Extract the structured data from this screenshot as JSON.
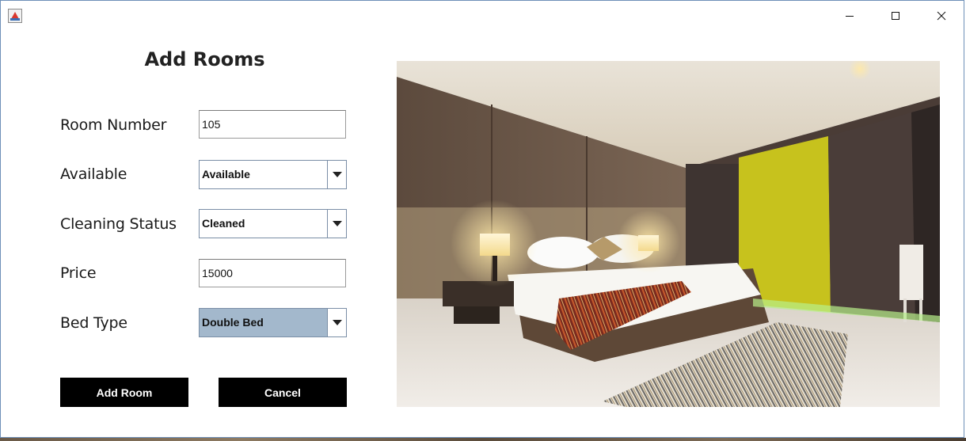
{
  "window": {
    "title_icon": "java-app-icon"
  },
  "form": {
    "title": "Add Rooms",
    "room_number": {
      "label": "Room Number",
      "value": "105"
    },
    "available": {
      "label": "Available",
      "value": "Available"
    },
    "cleaning_status": {
      "label": "Cleaning Status",
      "value": "Cleaned"
    },
    "price": {
      "label": "Price",
      "value": "15000"
    },
    "bed_type": {
      "label": "Bed Type",
      "value": "Double Bed"
    }
  },
  "buttons": {
    "add_room": "Add Room",
    "cancel": "Cancel"
  },
  "image": {
    "icon": "hotel-room-photo"
  },
  "colors": {
    "button_bg": "#000000",
    "selected_combo_bg": "#a3b8cc",
    "window_border": "#6d8fb8"
  }
}
